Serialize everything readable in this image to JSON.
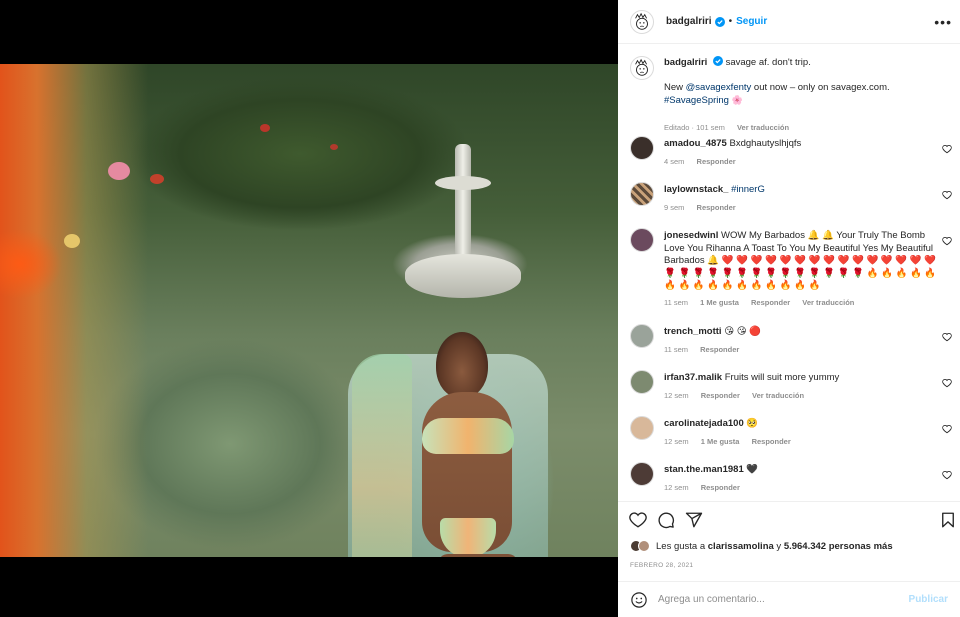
{
  "post": {
    "username": "badgalriri",
    "follow_label": "Seguir",
    "more_label": "•••",
    "caption_line1": "savage af. don't trip.",
    "caption_line2_pre": "New ",
    "caption_mention": "@savagexfenty",
    "caption_line2_post": " out now – only on savagex.com.",
    "caption_hashtag": "#SavageSpring",
    "caption_emoji": "🌸",
    "caption_meta_time": "Editado · 101 sem",
    "caption_meta_translate": "Ver traducción"
  },
  "comments": [
    {
      "username": "amadou_4875",
      "text": "Bxdghautyslhjqfs",
      "time": "4 sem",
      "likes": "",
      "reply": "Responder",
      "translate": ""
    },
    {
      "username": "laylownstack_",
      "text": "#innerG",
      "time": "9 sem",
      "likes": "",
      "reply": "Responder",
      "translate": ""
    },
    {
      "username": "jonesedwinl",
      "text": "WOW My Barbados 🔔 🔔 Your Truly The Bomb Love You Rihanna A Toast To You My Beautiful Yes My Beautiful Barbados 🔔 ❤️ ❤️ ❤️ ❤️ ❤️ ❤️ ❤️ ❤️ ❤️ ❤️ ❤️ ❤️ ❤️ ❤️ ❤️ 🌹 🌹 🌹 🌹 🌹 🌹 🌹 🌹 🌹 🌹 🌹 🌹 🌹 🌹 🔥 🔥 🔥 🔥 🔥 🔥 🔥 🔥 🔥 🔥 🔥 🔥 🔥 🔥 🔥 🔥",
      "time": "11 sem",
      "likes": "1 Me gusta",
      "reply": "Responder",
      "translate": "Ver traducción"
    },
    {
      "username": "trench_motti",
      "text": "😘 😘 🔴",
      "time": "11 sem",
      "likes": "",
      "reply": "Responder",
      "translate": ""
    },
    {
      "username": "irfan37.malik",
      "text": "Fruits will suit more yummy",
      "time": "12 sem",
      "likes": "",
      "reply": "Responder",
      "translate": "Ver traducción"
    },
    {
      "username": "carolinatejada100",
      "text": "🥺",
      "time": "12 sem",
      "likes": "1 Me gusta",
      "reply": "Responder",
      "translate": ""
    },
    {
      "username": "stan.the.man1981",
      "text": "🖤",
      "time": "12 sem",
      "likes": "",
      "reply": "Responder",
      "translate": ""
    }
  ],
  "likes": {
    "pre": "Les gusta a ",
    "user": "clarissamolina",
    "mid": " y ",
    "count": "5.964.342 personas más"
  },
  "date": "FEBRERO 28, 2021",
  "add_comment": {
    "placeholder": "Agrega un comentario...",
    "publish_label": "Publicar"
  },
  "icons": {
    "like": "heart-icon",
    "comment": "comment-icon",
    "share": "paper-plane-icon",
    "save": "bookmark-icon",
    "emoji": "smiley-icon",
    "verified": "verified-badge-icon"
  },
  "colors": {
    "accent": "#0095f6",
    "muted": "#8e8e8e",
    "text": "#262626",
    "link": "#00376b",
    "publish_disabled": "#b2dffc"
  }
}
